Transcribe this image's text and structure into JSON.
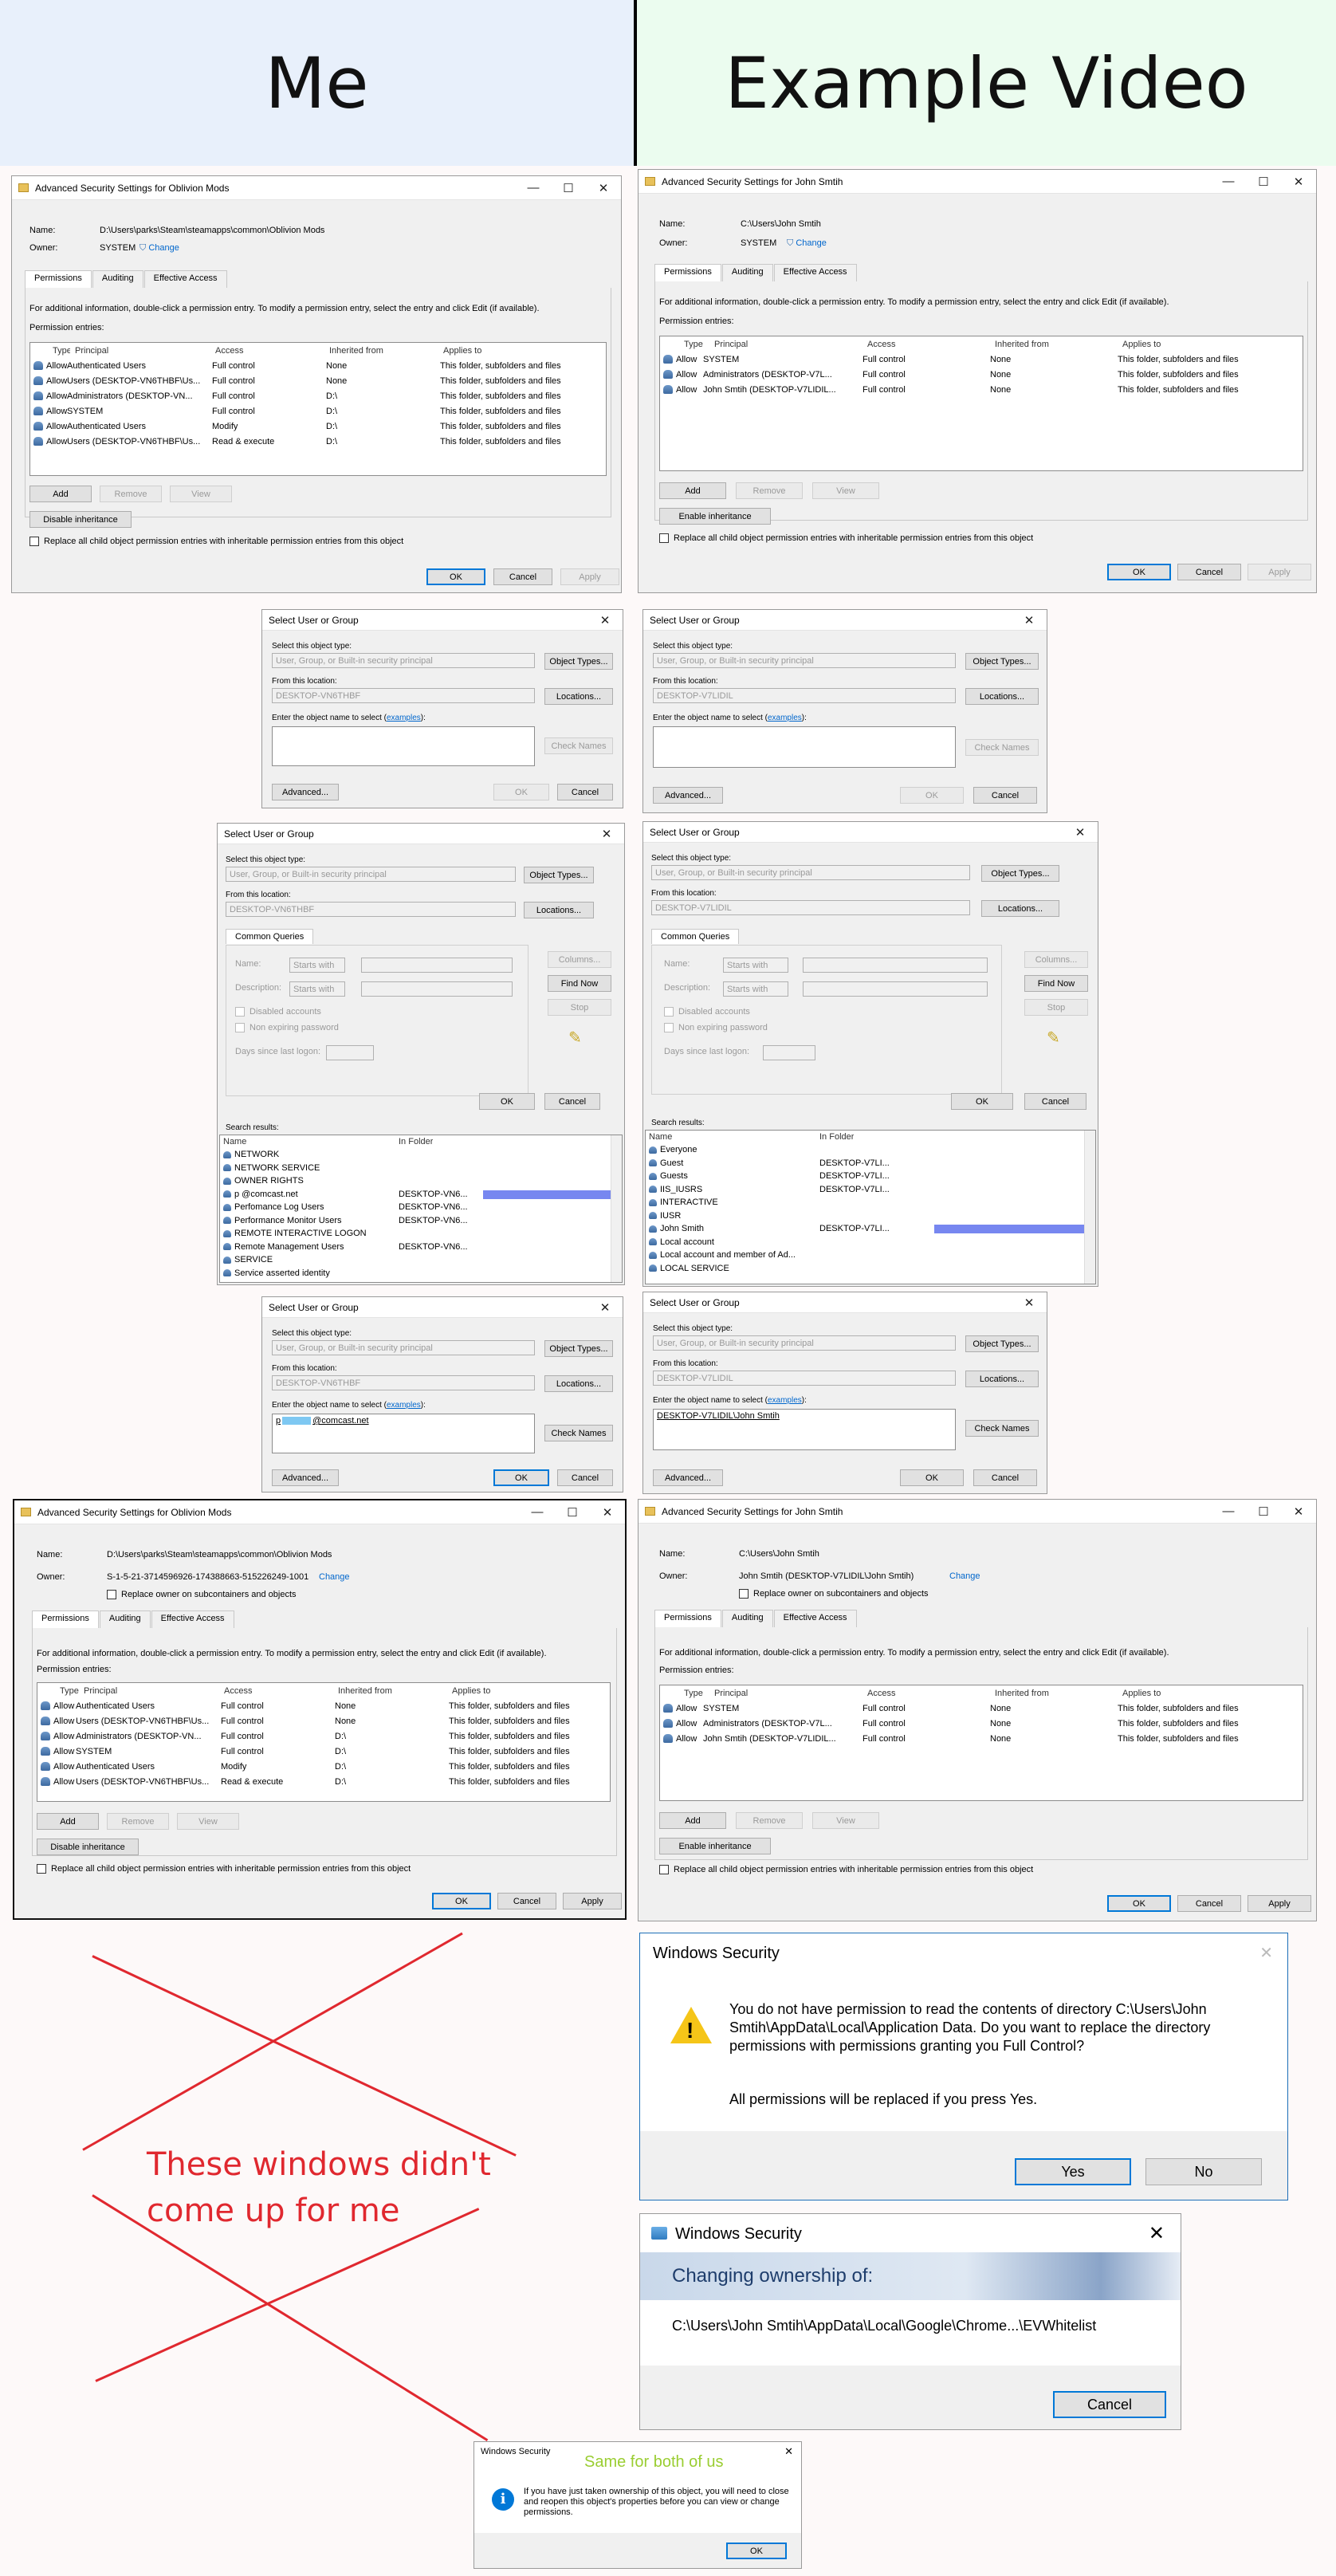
{
  "headers": {
    "left": "Me",
    "right": "Example Video"
  },
  "colors": {
    "left_panel": "#e8f0fb",
    "right_panel": "#ebfcef",
    "accent_red": "#e0282f",
    "info_blue": "#0078d7",
    "annotation_green": "#9acd32"
  },
  "adv1_me": {
    "title": "Advanced Security Settings for Oblivion Mods",
    "name_label": "Name:",
    "name_value": "D:\\Users\\parks\\Steam\\steamapps\\common\\Oblivion Mods",
    "owner_label": "Owner:",
    "owner_value": "SYSTEM",
    "change_label": "Change",
    "tabs": [
      "Permissions",
      "Auditing",
      "Effective Access"
    ],
    "info": "For additional information, double-click a permission entry. To modify a permission entry, select the entry and click Edit (if available).",
    "entries_label": "Permission entries:",
    "columns": [
      "Type",
      "Principal",
      "Access",
      "Inherited from",
      "Applies to"
    ],
    "rows": [
      [
        "Allow",
        "Authenticated Users",
        "Full control",
        "None",
        "This folder, subfolders and files"
      ],
      [
        "Allow",
        "Users (DESKTOP-VN6THBF\\Us...",
        "Full control",
        "None",
        "This folder, subfolders and files"
      ],
      [
        "Allow",
        "Administrators (DESKTOP-VN...",
        "Full control",
        "D:\\",
        "This folder, subfolders and files"
      ],
      [
        "Allow",
        "SYSTEM",
        "Full control",
        "D:\\",
        "This folder, subfolders and files"
      ],
      [
        "Allow",
        "Authenticated Users",
        "Modify",
        "D:\\",
        "This folder, subfolders and files"
      ],
      [
        "Allow",
        "Users (DESKTOP-VN6THBF\\Us...",
        "Read & execute",
        "D:\\",
        "This folder, subfolders and files"
      ]
    ],
    "add": "Add",
    "remove": "Remove",
    "view": "View",
    "disable_inh": "Disable inheritance",
    "replace_check": "Replace all child object permission entries with inheritable permission entries from this object",
    "ok": "OK",
    "cancel": "Cancel",
    "apply": "Apply"
  },
  "adv1_ex": {
    "title": "Advanced Security Settings for John Smtih",
    "name_label": "Name:",
    "name_value": "C:\\Users\\John Smtih",
    "owner_label": "Owner:",
    "owner_value": "SYSTEM",
    "change_label": "Change",
    "tabs": [
      "Permissions",
      "Auditing",
      "Effective Access"
    ],
    "info": "For additional information, double-click a permission entry. To modify a permission entry, select the entry and click Edit (if available).",
    "entries_label": "Permission entries:",
    "columns": [
      "Type",
      "Principal",
      "Access",
      "Inherited from",
      "Applies to"
    ],
    "rows": [
      [
        "Allow",
        "SYSTEM",
        "Full control",
        "None",
        "This folder, subfolders and files"
      ],
      [
        "Allow",
        "Administrators (DESKTOP-V7L...",
        "Full control",
        "None",
        "This folder, subfolders and files"
      ],
      [
        "Allow",
        "John Smtih (DESKTOP-V7LIDIL...",
        "Full control",
        "None",
        "This folder, subfolders and files"
      ]
    ],
    "add": "Add",
    "remove": "Remove",
    "view": "View",
    "enable_inh": "Enable inheritance",
    "replace_check": "Replace all child object permission entries with inheritable permission entries from this object",
    "ok": "OK",
    "cancel": "Cancel",
    "apply": "Apply"
  },
  "sel_common": {
    "title": "Select User or Group",
    "type_label": "Select this object type:",
    "type_value": "User, Group, or Built-in security principal",
    "object_types": "Object Types...",
    "loc_label": "From this location:",
    "locations": "Locations...",
    "enter_label": "Enter the object name to select",
    "examples": "examples",
    "check_names": "Check Names",
    "advanced": "Advanced...",
    "ok": "OK",
    "cancel": "Cancel"
  },
  "sel1_me": {
    "location": "DESKTOP-VN6THBF"
  },
  "sel1_ex": {
    "location": "DESKTOP-V7LIDIL"
  },
  "sel3_me": {
    "location": "DESKTOP-VN6THBF",
    "typed_prefix": "p",
    "typed_suffix": "@comcast.net"
  },
  "sel3_ex": {
    "location": "DESKTOP-V7LIDIL",
    "typed": "DESKTOP-V7LIDIL\\John Smtih"
  },
  "sel_adv_common": {
    "common_queries": "Common Queries",
    "name": "Name:",
    "description": "Description:",
    "starts_with": "Starts with",
    "disabled_accounts": "Disabled accounts",
    "non_expiring": "Non expiring password",
    "days_since": "Days since last logon:",
    "columns": "Columns...",
    "find_now": "Find Now",
    "stop": "Stop",
    "search_results": "Search results:",
    "col_name": "Name",
    "col_folder": "In Folder",
    "ok": "OK",
    "cancel": "Cancel"
  },
  "sel_adv_me": {
    "location": "DESKTOP-VN6THBF",
    "results": [
      [
        "NETWORK",
        ""
      ],
      [
        "NETWORK SERVICE",
        ""
      ],
      [
        "OWNER RIGHTS",
        ""
      ],
      [
        "p          @comcast.net",
        "DESKTOP-VN6..."
      ],
      [
        "Perfomance Log Users",
        "DESKTOP-VN6..."
      ],
      [
        "Performance Monitor Users",
        "DESKTOP-VN6..."
      ],
      [
        "REMOTE INTERACTIVE LOGON",
        ""
      ],
      [
        "Remote Management Users",
        "DESKTOP-VN6..."
      ],
      [
        "SERVICE",
        ""
      ],
      [
        "Service asserted identity",
        ""
      ]
    ]
  },
  "sel_adv_ex": {
    "location": "DESKTOP-V7LIDIL",
    "results": [
      [
        "Everyone",
        ""
      ],
      [
        "Guest",
        "DESKTOP-V7LI..."
      ],
      [
        "Guests",
        "DESKTOP-V7LI..."
      ],
      [
        "IIS_IUSRS",
        "DESKTOP-V7LI..."
      ],
      [
        "INTERACTIVE",
        ""
      ],
      [
        "IUSR",
        ""
      ],
      [
        "John Smith",
        "DESKTOP-V7LI..."
      ],
      [
        "Local account",
        ""
      ],
      [
        "Local account and member of Ad...",
        ""
      ],
      [
        "LOCAL SERVICE",
        ""
      ]
    ]
  },
  "adv2_me": {
    "title": "Advanced Security Settings for Oblivion Mods",
    "name_label": "Name:",
    "name_value": "D:\\Users\\parks\\Steam\\steamapps\\common\\Oblivion Mods",
    "owner_label": "Owner:",
    "owner_value": "S-1-5-21-3714596926-174388663-515226249-1001",
    "change_label": "Change",
    "replace_owner": "Replace owner on subcontainers and objects",
    "tabs": [
      "Permissions",
      "Auditing",
      "Effective Access"
    ],
    "info": "For additional information, double-click a permission entry. To modify a permission entry, select the entry and click Edit (if available).",
    "entries_label": "Permission entries:",
    "columns": [
      "Type",
      "Principal",
      "Access",
      "Inherited from",
      "Applies to"
    ],
    "rows": [
      [
        "Allow",
        "Authenticated Users",
        "Full control",
        "None",
        "This folder, subfolders and files"
      ],
      [
        "Allow",
        "Users (DESKTOP-VN6THBF\\Us...",
        "Full control",
        "None",
        "This folder, subfolders and files"
      ],
      [
        "Allow",
        "Administrators (DESKTOP-VN...",
        "Full control",
        "D:\\",
        "This folder, subfolders and files"
      ],
      [
        "Allow",
        "SYSTEM",
        "Full control",
        "D:\\",
        "This folder, subfolders and files"
      ],
      [
        "Allow",
        "Authenticated Users",
        "Modify",
        "D:\\",
        "This folder, subfolders and files"
      ],
      [
        "Allow",
        "Users (DESKTOP-VN6THBF\\Us...",
        "Read & execute",
        "D:\\",
        "This folder, subfolders and files"
      ]
    ],
    "add": "Add",
    "remove": "Remove",
    "view": "View",
    "disable_inh": "Disable inheritance",
    "replace_check": "Replace all child object permission entries with inheritable permission entries from this object",
    "ok": "OK",
    "cancel": "Cancel",
    "apply": "Apply"
  },
  "adv2_ex": {
    "title": "Advanced Security Settings for John Smtih",
    "name_label": "Name:",
    "name_value": "C:\\Users\\John Smtih",
    "owner_label": "Owner:",
    "owner_value": "John Smtih (DESKTOP-V7LIDIL\\John Smtih)",
    "change_label": "Change",
    "replace_owner": "Replace owner on subcontainers and objects",
    "tabs": [
      "Permissions",
      "Auditing",
      "Effective Access"
    ],
    "info": "For additional information, double-click a permission entry. To modify a permission entry, select the entry and click Edit (if available).",
    "entries_label": "Permission entries:",
    "columns": [
      "Type",
      "Principal",
      "Access",
      "Inherited from",
      "Applies to"
    ],
    "rows": [
      [
        "Allow",
        "SYSTEM",
        "Full control",
        "None",
        "This folder, subfolders and files"
      ],
      [
        "Allow",
        "Administrators (DESKTOP-V7L...",
        "Full control",
        "None",
        "This folder, subfolders and files"
      ],
      [
        "Allow",
        "John Smtih (DESKTOP-V7LIDIL...",
        "Full control",
        "None",
        "This folder, subfolders and files"
      ]
    ],
    "add": "Add",
    "remove": "Remove",
    "view": "View",
    "enable_inh": "Enable inheritance",
    "replace_check": "Replace all child object permission entries with inheritable permission entries from this object",
    "ok": "OK",
    "cancel": "Cancel",
    "apply": "Apply"
  },
  "annotation": {
    "line1": "These windows didn't",
    "line2": "come up for me"
  },
  "winsec": {
    "title": "Windows Security",
    "message": "You do not have permission to read the contents of directory C:\\Users\\John Smtih\\AppData\\Local\\Application Data. Do you want to replace the directory permissions with permissions granting you Full Control?",
    "note": "All permissions will be replaced if you press Yes.",
    "yes": "Yes",
    "no": "No"
  },
  "changing": {
    "title": "Windows Security",
    "heading": "Changing ownership of:",
    "path": "C:\\Users\\John Smtih\\AppData\\Local\\Google\\Chrome...\\EVWhitelist",
    "cancel": "Cancel"
  },
  "final": {
    "title": "Windows Security",
    "annotation": "Same for both of us",
    "message": "If you have just taken ownership of this object, you will need to close and reopen this object's properties before you can view or change permissions.",
    "ok": "OK"
  }
}
